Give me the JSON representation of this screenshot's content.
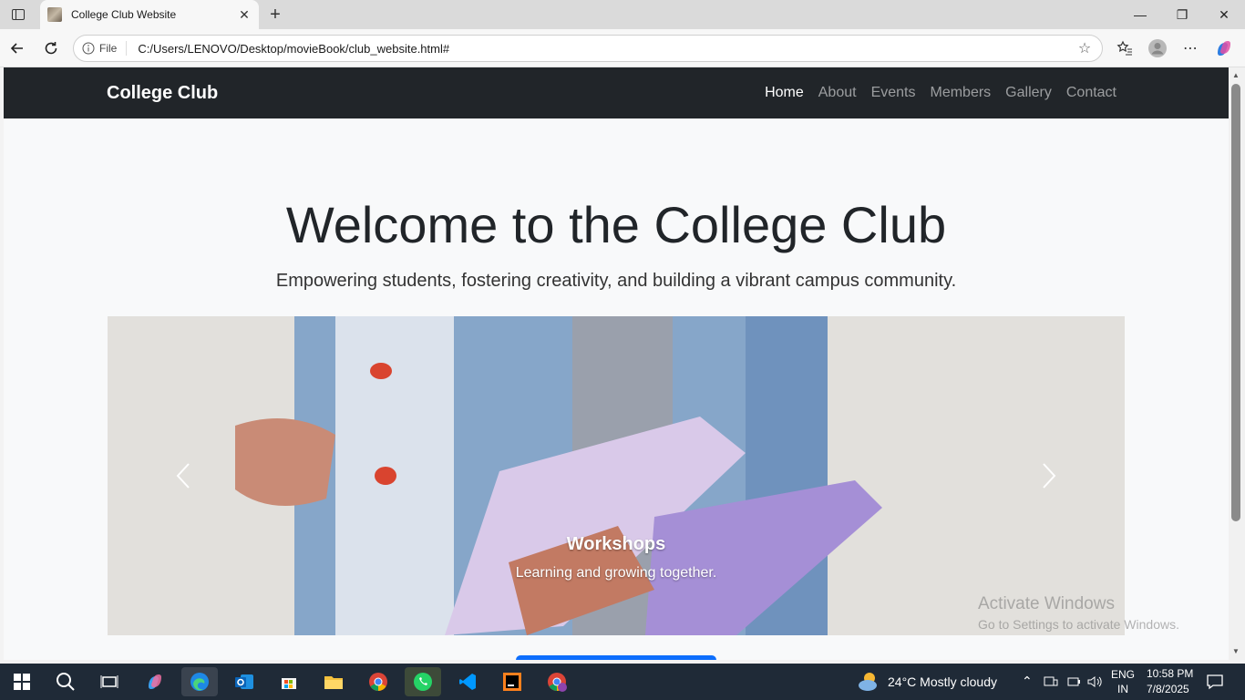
{
  "browser": {
    "tab_title": "College Club Website",
    "omnibox_chip": "File",
    "url": "C:/Users/LENOVO/Desktop/movieBook/club_website.html#"
  },
  "site": {
    "brand": "College Club",
    "nav": [
      {
        "label": "Home",
        "active": true
      },
      {
        "label": "About",
        "active": false
      },
      {
        "label": "Events",
        "active": false
      },
      {
        "label": "Members",
        "active": false
      },
      {
        "label": "Gallery",
        "active": false
      },
      {
        "label": "Contact",
        "active": false
      }
    ],
    "hero_title": "Welcome to the College Club",
    "hero_subtitle": "Empowering students, fostering creativity, and building a vibrant campus community.",
    "carousel": {
      "caption_title": "Workshops",
      "caption_text": "Learning and growing together.",
      "prev_icon": "chevron-left-icon",
      "next_icon": "chevron-right-icon"
    }
  },
  "watermark": {
    "line1": "Activate Windows",
    "line2": "Go to Settings to activate Windows."
  },
  "taskbar": {
    "weather": "24°C  Mostly cloudy",
    "lang1": "ENG",
    "lang2": "IN",
    "time": "10:58 PM",
    "date": "7/8/2025"
  },
  "colors": {
    "navbar": "#212529",
    "page_bg": "#f8f9fa",
    "primary": "#0d6efd",
    "taskbar": "#1f2a37"
  }
}
